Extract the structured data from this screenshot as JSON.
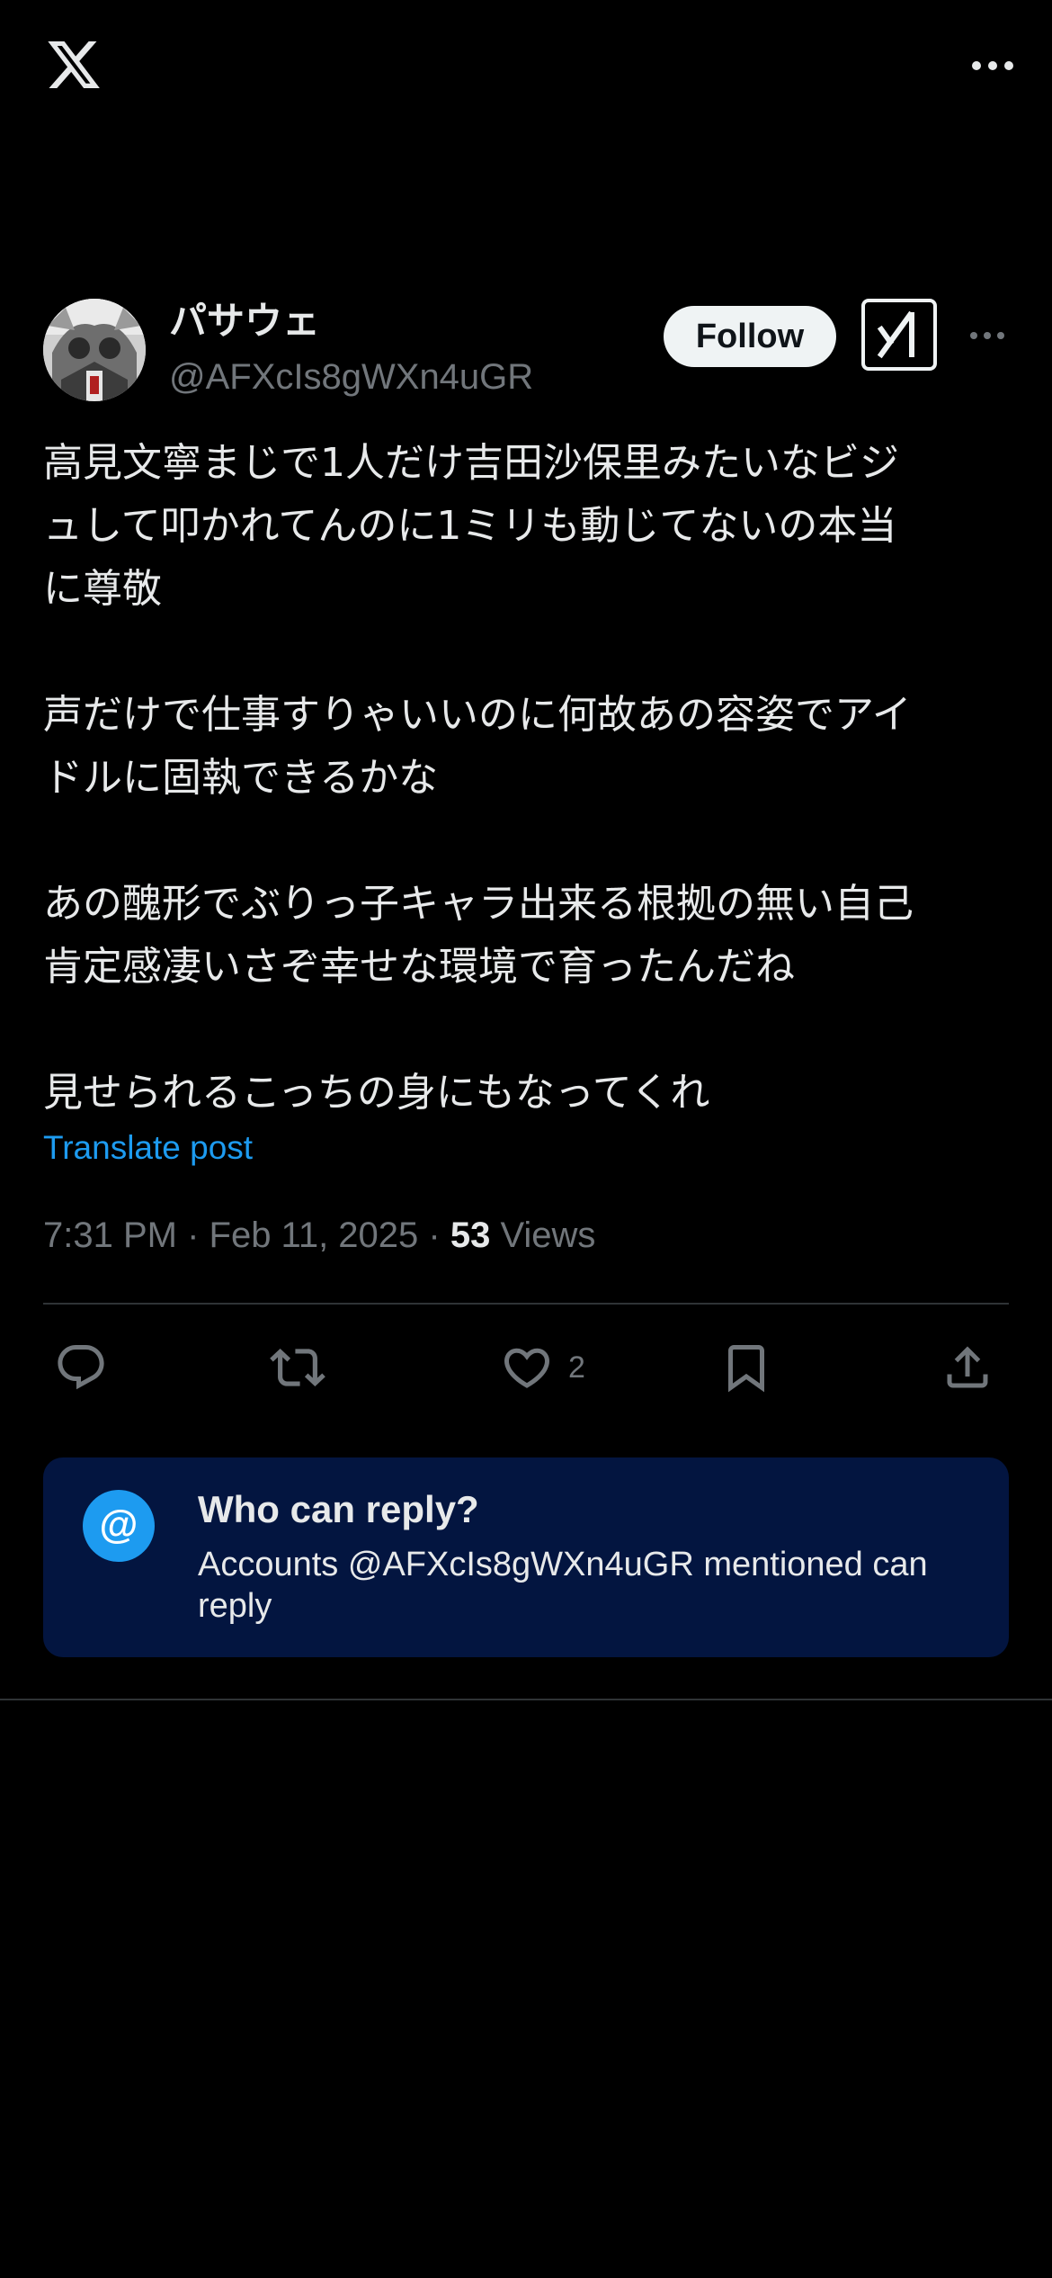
{
  "topbar": {
    "logo_icon": "x-logo-icon",
    "more_icon": "more-horizontal-icon"
  },
  "author": {
    "display_name": "パサウェ",
    "handle": "@AFXcIs8gWXn4uGR",
    "follow_label": "Follow",
    "grok_icon": "grok-icon",
    "more_icon": "more-horizontal-icon"
  },
  "tweet": {
    "paragraphs": [
      "高見文寧まじで1人だけ吉田沙保里みたいなビジ\nュして叩かれてんのに1ミリも動じてないの本当\nに尊敬",
      "声だけで仕事すりゃいいのに何故あの容姿でアイ\nドルに固執できるかな",
      "あの醜形でぶりっ子キャラ出来る根拠の無い自己\n肯定感凄いさぞ幸せな環境で育ったんだね",
      "見せられるこっちの身にもなってくれ"
    ],
    "translate_label": "Translate post",
    "time": "7:31 PM",
    "separator": " · ",
    "date": "Feb 11, 2025",
    "views_count": "53",
    "views_label": " Views"
  },
  "actions": {
    "reply_icon": "reply-icon",
    "retweet_icon": "retweet-icon",
    "like_icon": "heart-icon",
    "like_count": "2",
    "bookmark_icon": "bookmark-icon",
    "share_icon": "share-icon"
  },
  "reply_restriction": {
    "icon": "@",
    "title": "Who can reply?",
    "description": "Accounts @AFXcIs8gWXn4uGR mentioned can reply"
  },
  "colors": {
    "background": "#000000",
    "text": "#e7e9ea",
    "secondary": "#71767b",
    "accent": "#1d9bf0",
    "reply_box": "#031540"
  }
}
